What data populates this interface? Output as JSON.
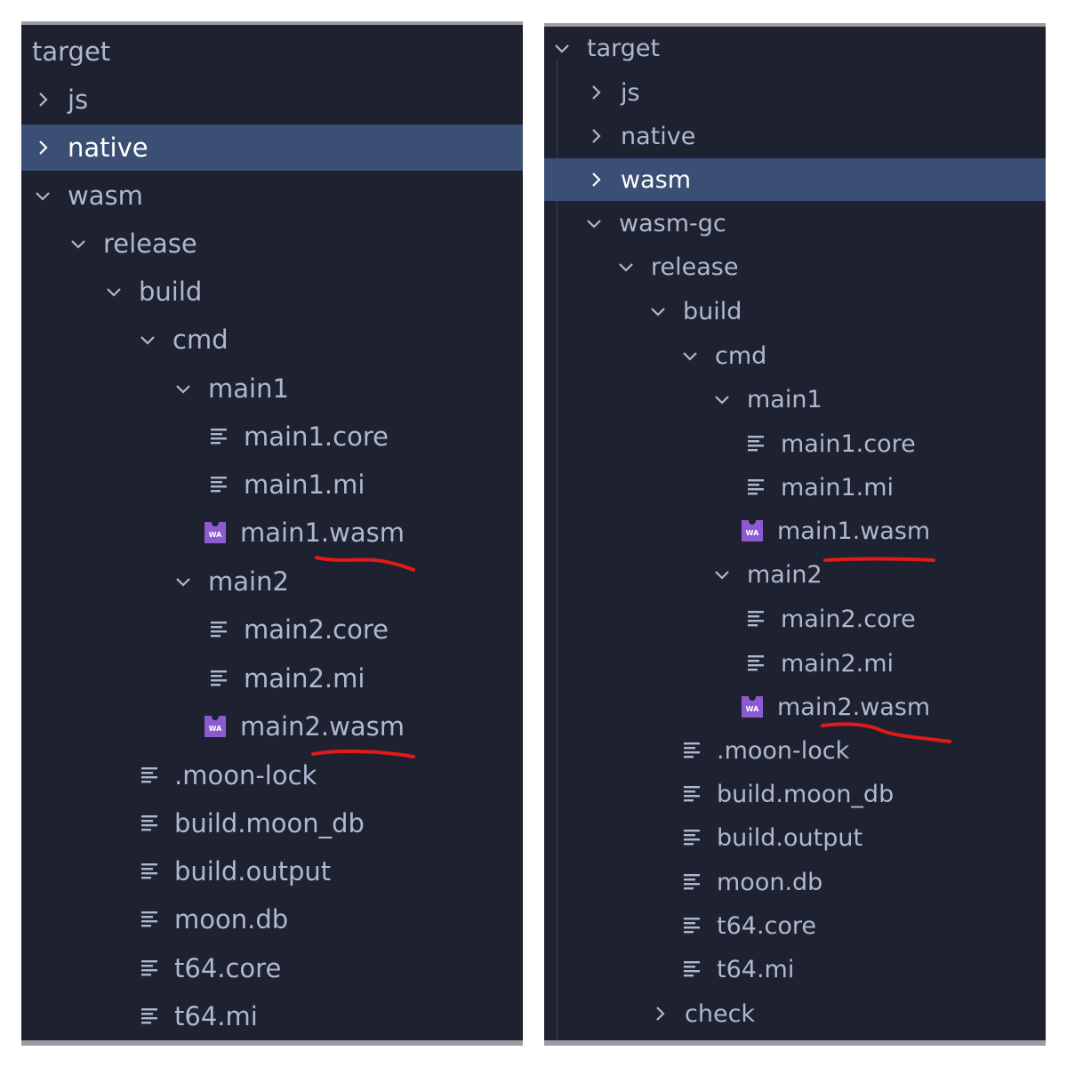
{
  "left_tree": {
    "target": "target",
    "js": "js",
    "native": "native",
    "wasm": "wasm",
    "release": "release",
    "build": "build",
    "cmd": "cmd",
    "main1": "main1",
    "main1_core": "main1.core",
    "main1_mi": "main1.mi",
    "main1_wasm": "main1.wasm",
    "main2": "main2",
    "main2_core": "main2.core",
    "main2_mi": "main2.mi",
    "main2_wasm": "main2.wasm",
    "moon_lock": ".moon-lock",
    "build_moon_db": "build.moon_db",
    "build_output": "build.output",
    "moon_db": "moon.db",
    "t64_core": "t64.core",
    "t64_mi": "t64.mi",
    "selected": "native"
  },
  "right_tree": {
    "target": "target",
    "js": "js",
    "native": "native",
    "wasm": "wasm",
    "wasm_gc": "wasm-gc",
    "release": "release",
    "build": "build",
    "cmd": "cmd",
    "main1": "main1",
    "main1_core": "main1.core",
    "main1_mi": "main1.mi",
    "main1_wasm": "main1.wasm",
    "main2": "main2",
    "main2_core": "main2.core",
    "main2_mi": "main2.mi",
    "main2_wasm": "main2.wasm",
    "moon_lock": ".moon-lock",
    "build_moon_db": "build.moon_db",
    "build_output": "build.output",
    "moon_db": "moon.db",
    "t64_core": "t64.core",
    "t64_mi": "t64.mi",
    "check": "check",
    "selected": "wasm"
  },
  "wasm_icon_text": "WA",
  "colors": {
    "panel_bg": "#1e2230",
    "selected_bg": "#3b4e73",
    "text": "#aeb8cf",
    "wasm_icon": "#8e5ad2",
    "annotation": "#e21a1a"
  }
}
